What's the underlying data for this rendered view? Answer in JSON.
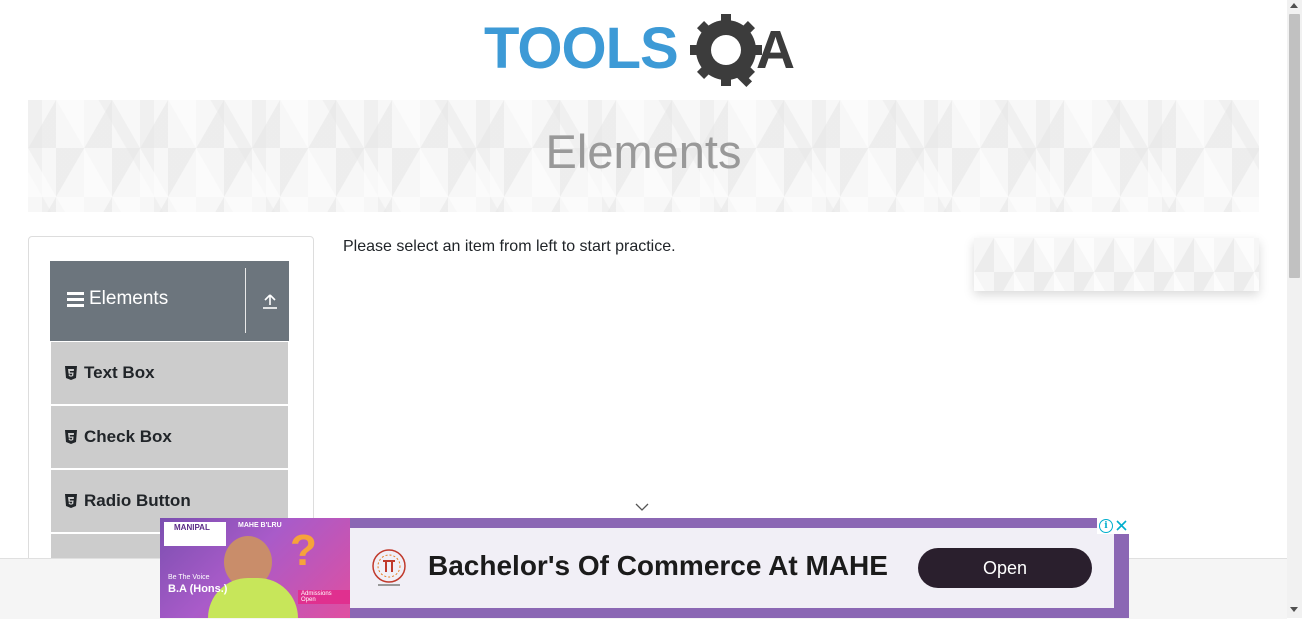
{
  "header": {
    "logo_text_left": "TOOLS",
    "logo_text_right": "A",
    "logo_icon": "gear-magnifier-icon",
    "brand_colors": {
      "tools_blue": "#3d9ad6",
      "qa_dark": "#3c3c3c"
    }
  },
  "banner": {
    "title": "Elements"
  },
  "sidebar": {
    "group": {
      "title": "Elements",
      "menu_icon": "hamburger-icon",
      "collapse_icon": "collapse-up-icon"
    },
    "items": [
      {
        "label": "Text Box",
        "icon": "html5-icon"
      },
      {
        "label": "Check Box",
        "icon": "html5-icon"
      },
      {
        "label": "Radio Button",
        "icon": "html5-icon"
      }
    ]
  },
  "main": {
    "message": "Please select an item from left to start practice."
  },
  "ad": {
    "brand": "MANIPAL",
    "brand_sub": "MAHE B'LRU",
    "tagline_small": "Be The Voice",
    "tagline_big": "B.A (Hons.)",
    "badge": "Admissions Open",
    "headline": "Bachelor's Of Commerce At MAHE",
    "cta": "Open",
    "colors": {
      "frame": "#8b67b4",
      "cta_bg": "#2a1f2d"
    }
  },
  "colors": {
    "sidebar_header": "#6c757d",
    "menu_item": "#cccccc",
    "banner_title": "#999999"
  }
}
